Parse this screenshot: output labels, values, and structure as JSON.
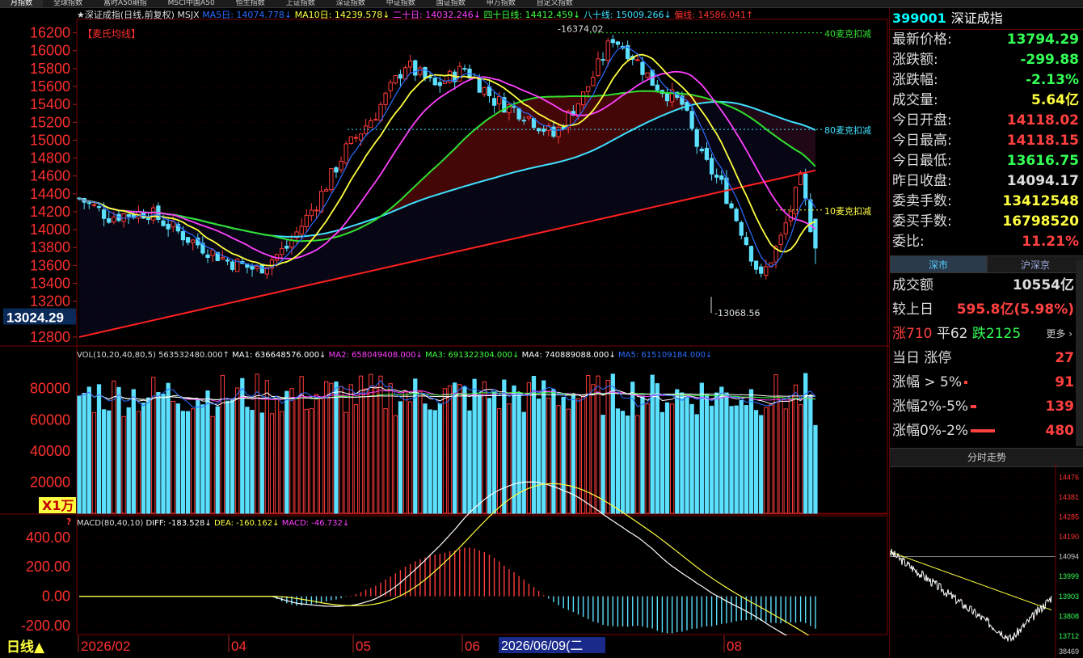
{
  "top_tabs": [
    "月指数",
    "全球指数",
    "富时A50期指",
    "MSCI中国A50",
    "恒生指数",
    "上证指数",
    "深证指数",
    "中证指数",
    "国证指数",
    "申万指数",
    "自定义指数"
  ],
  "active_tab": 0,
  "main_legend": {
    "title": "★深证成指(日线,前复权) MSJX",
    "items": [
      {
        "text": "MA5日: 14074.778↓",
        "color": "#2a6dff"
      },
      {
        "text": "MA10日: 14239.578↓",
        "color": "#ffff40"
      },
      {
        "text": "二十日: 14032.246↓",
        "color": "#ff40ff"
      },
      {
        "text": "四十日线: 14412.459↓",
        "color": "#40ff40"
      },
      {
        "text": "八十线: 15009.266↓",
        "color": "#40e0ff"
      },
      {
        "text": "偏线: 14586.041↑",
        "color": "#ff3030"
      }
    ],
    "tag": "【麦氏均线】"
  },
  "price_axis": [
    "16200",
    "16000",
    "15800",
    "15600",
    "15400",
    "15200",
    "15000",
    "14800",
    "14600",
    "14400",
    "14200",
    "14000",
    "13800",
    "13600",
    "13400",
    "13200",
    "13000",
    "12800"
  ],
  "current_price_label": "13024.29",
  "annotations": {
    "high": "16374.02",
    "low": "13068.56",
    "k40": "40麦克扣减",
    "k80": "80麦克扣减",
    "k10": "10麦克扣减"
  },
  "vol_legend": {
    "title": "VOL(10,20,40,80,5) 563532480.000↑",
    "items": [
      {
        "text": "MA1: 636648576.000↓",
        "color": "#ffffff"
      },
      {
        "text": "MA2: 658049408.000↓",
        "color": "#ff40ff"
      },
      {
        "text": "MA3: 691322304.000↓",
        "color": "#40ff40"
      },
      {
        "text": "MA4: 740889088.000↓",
        "color": "#ffffff"
      },
      {
        "text": "MA5: 615109184.000↓",
        "color": "#2a6dff"
      }
    ]
  },
  "vol_axis": [
    "80000",
    "60000",
    "40000",
    "20000"
  ],
  "vol_unit": "X1万",
  "macd_legend": {
    "title": "MACD(80,40,10)",
    "items": [
      {
        "text": "DIFF: -183.528↓",
        "color": "#ffffff"
      },
      {
        "text": "DEA: -160.162↓",
        "color": "#ffff40"
      },
      {
        "text": "MACD: -46.732↓",
        "color": "#ff40ff"
      }
    ]
  },
  "macd_axis": [
    "400.00",
    "200.00",
    "0.00",
    "-200.00"
  ],
  "bottom": {
    "period": "日线▲",
    "months": [
      "2026/02",
      "04",
      "05",
      "06",
      "08"
    ],
    "cursor_date": "2026/06/09(二"
  },
  "sidebar": {
    "code": "399001",
    "name": "深证成指",
    "quotes": [
      {
        "label": "最新价格:",
        "value": "13794.29",
        "color": "green"
      },
      {
        "label": "涨跌额:",
        "value": "-299.88",
        "color": "green"
      },
      {
        "label": "涨跌幅:",
        "value": "-2.13%",
        "color": "green"
      },
      {
        "label": "成交量:",
        "value": "5.64亿",
        "color": "yellow"
      },
      {
        "label": "今日开盘:",
        "value": "14118.02",
        "color": "red"
      },
      {
        "label": "今日最高:",
        "value": "14118.15",
        "color": "red"
      },
      {
        "label": "今日最低:",
        "value": "13616.75",
        "color": "green"
      },
      {
        "label": "昨日收盘:",
        "value": "14094.17",
        "color": "white"
      },
      {
        "label": "委卖手数:",
        "value": "13412548",
        "color": "yellow"
      },
      {
        "label": "委买手数:",
        "value": "16798520",
        "color": "yellow"
      },
      {
        "label": "委比:",
        "value": "11.21%",
        "color": "red"
      }
    ],
    "tabs": [
      "深市",
      "沪深京"
    ],
    "turnover_label": "成交额",
    "turnover_value": "10554亿",
    "compare_label": "较上日",
    "compare_value": "595.8亿(5.98%)",
    "up_text": "涨710",
    "flat_text": "平62",
    "down_text": "跌2125",
    "more": "更多",
    "stats": [
      {
        "label": "当日 涨停",
        "value": "27",
        "bar": 0
      },
      {
        "label": "涨幅 > 5%",
        "value": "91",
        "bar": 4
      },
      {
        "label": "涨幅2%-5%",
        "value": "139",
        "bar": 7
      },
      {
        "label": "涨幅0%-2%",
        "value": "480",
        "bar": 30
      }
    ],
    "mini_title": "分时走势",
    "mini_axis": [
      "14476",
      "14381",
      "14285",
      "14190",
      "14094",
      "13999",
      "13903",
      "13808",
      "13712",
      "38469"
    ]
  },
  "chart_data": {
    "type": "candlestick",
    "title": "深证成指(日线,前复权)",
    "series": [
      {
        "name": "MA5日",
        "last": 14074.778
      },
      {
        "name": "MA10日",
        "last": 14239.578
      },
      {
        "name": "二十日",
        "last": 14032.246
      },
      {
        "name": "四十日线",
        "last": 14412.459
      },
      {
        "name": "八十线",
        "last": 15009.266
      },
      {
        "name": "偏线",
        "last": 14586.041
      }
    ],
    "high_label": 16374.02,
    "low_label": 13068.56,
    "last_close": 13794.29,
    "ylim": [
      12700,
      16350
    ]
  }
}
